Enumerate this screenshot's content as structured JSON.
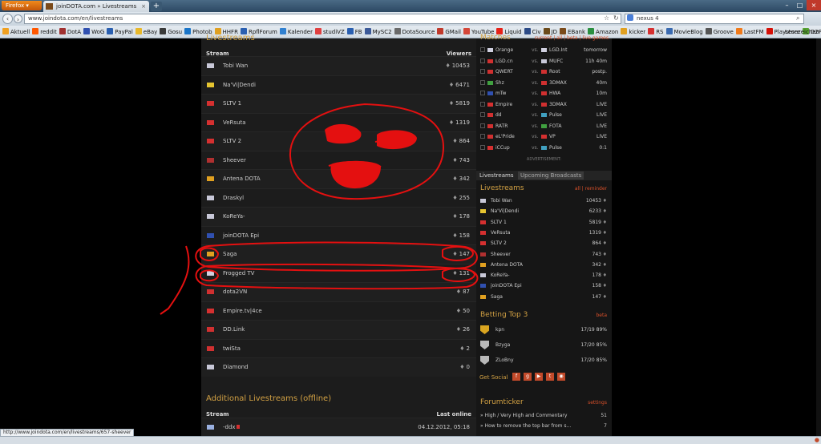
{
  "browser": {
    "menu_label": "Firefox",
    "tab_title": "joinDOTA.com » Livestreams",
    "url": "www.joindota.com/en/livestreams",
    "search_value": "nexus 4",
    "status_url": "http://www.joindota.com/en/livestreams/657-sheever",
    "bookmarks": [
      "Aktuell",
      "reddit",
      "DotA",
      "WoG",
      "PayPal",
      "eBay",
      "Gosu",
      "Photob",
      "HHFR",
      "RpflForum",
      "Kalender",
      "studiVZ",
      "FB",
      "MySC2",
      "DotaSource",
      "GMail",
      "YouTube",
      "Liquid",
      "Civ",
      "JD",
      "EBank",
      "Amazon",
      "kicker",
      "RS",
      "MovieBlog",
      "Groove",
      "LastFM",
      "Playstore",
      "D2PU"
    ],
    "bookmarks_end": "Lesezeichen"
  },
  "main": {
    "title": "Livestreams",
    "col_stream": "Stream",
    "col_viewers": "Viewers",
    "streams": [
      {
        "name": "Tobi Wan",
        "viewers": "10453",
        "flag": "#c8c8d8"
      },
      {
        "name": "Na'Vi|Dendi",
        "viewers": "6471",
        "flag": "#e5c430"
      },
      {
        "name": "SLTV 1",
        "viewers": "5819",
        "flag": "#d53030"
      },
      {
        "name": "VeRsuta",
        "viewers": "1319",
        "flag": "#d53030"
      },
      {
        "name": "SLTV 2",
        "viewers": "864",
        "flag": "#d53030"
      },
      {
        "name": "Sheever",
        "viewers": "743",
        "flag": "#b03030"
      },
      {
        "name": "Antena DOTA",
        "viewers": "342",
        "flag": "#e0a020"
      },
      {
        "name": "Draskyl",
        "viewers": "255",
        "flag": "#c8c8d8"
      },
      {
        "name": "KoReYa-",
        "viewers": "178",
        "flag": "#c8c8d8"
      },
      {
        "name": "joinDOTA Epi",
        "viewers": "158",
        "flag": "#3050b0"
      },
      {
        "name": "Saga",
        "viewers": "147",
        "flag": "#e0a020"
      },
      {
        "name": "Frogged TV",
        "viewers": "131",
        "flag": "#d0d0e0"
      },
      {
        "name": "dota2VN",
        "viewers": "87",
        "flag": "#d03030"
      },
      {
        "name": "Empire.tv|4ce",
        "viewers": "50",
        "flag": "#d53030"
      },
      {
        "name": "DD.Link",
        "viewers": "26",
        "flag": "#d03030"
      },
      {
        "name": "twiSta",
        "viewers": "2",
        "flag": "#d03030"
      },
      {
        "name": "Diamond",
        "viewers": "0",
        "flag": "#c8c8d8"
      }
    ],
    "offline_title": "Additional Livestreams (offline)",
    "offline_col_stream": "Stream",
    "offline_col_last": "Last online",
    "offline_rows": [
      {
        "name": "-ddx",
        "last": "04.12.2012, 05:18",
        "flag": "#9ab0e0"
      }
    ]
  },
  "side": {
    "matches_title": "Matches",
    "matches_links": "current | all | beta | live games",
    "matches": [
      {
        "t1": "Orange",
        "t2": "LGD.Int",
        "time": "tomorrow",
        "f1": "#d0d0e0",
        "f2": "#d0d0e0"
      },
      {
        "t1": "LGD.cn",
        "t2": "MUFC",
        "time": "11h 40m",
        "f1": "#d03030",
        "f2": "#c8c8d8"
      },
      {
        "t1": "QWERT",
        "t2": "Root",
        "time": "postp.",
        "f1": "#d03030",
        "f2": "#d03030"
      },
      {
        "t1": "Shz",
        "t2": "3DMAX",
        "time": "40m",
        "f1": "#40a040",
        "f2": "#d03030"
      },
      {
        "t1": "mTw",
        "t2": "HWA",
        "time": "10m",
        "f1": "#3050b0",
        "f2": "#d03030"
      },
      {
        "t1": "Empire",
        "t2": "3DMAX",
        "time": "LIVE",
        "f1": "#d53030",
        "f2": "#d03030"
      },
      {
        "t1": "dd",
        "t2": "Pulse",
        "time": "LIVE",
        "f1": "#d03030",
        "f2": "#40a0c0"
      },
      {
        "t1": "RATR",
        "t2": "FOTA",
        "time": "LIVE",
        "f1": "#d03030",
        "f2": "#40a040"
      },
      {
        "t1": "eL'Pride",
        "t2": "VP",
        "time": "LIVE",
        "f1": "#d03030",
        "f2": "#d53030"
      },
      {
        "t1": "iCCup",
        "t2": "Pulse",
        "time": "0:1",
        "f1": "#d53030",
        "f2": "#40a0c0"
      }
    ],
    "advertisement": "ADVERTISEMENT:",
    "tab_live": "Livestreams",
    "tab_upcoming": "Upcoming Broadcasts",
    "live_title": "Livestreams",
    "live_links": "all | reminder",
    "live_streams": [
      {
        "name": "Tobi Wan",
        "viewers": "10453",
        "flag": "#c8c8d8"
      },
      {
        "name": "Na'Vi|Dendi",
        "viewers": "6233",
        "flag": "#e5c430"
      },
      {
        "name": "SLTV 1",
        "viewers": "5819",
        "flag": "#d53030"
      },
      {
        "name": "VeRsuta",
        "viewers": "1319",
        "flag": "#d53030"
      },
      {
        "name": "SLTV 2",
        "viewers": "864",
        "flag": "#d53030"
      },
      {
        "name": "Sheever",
        "viewers": "743",
        "flag": "#b03030"
      },
      {
        "name": "Antena DOTA",
        "viewers": "342",
        "flag": "#e0a020"
      },
      {
        "name": "KoReYa-",
        "viewers": "178",
        "flag": "#c8c8d8"
      },
      {
        "name": "joinDOTA Epi",
        "viewers": "158",
        "flag": "#3050b0"
      },
      {
        "name": "Saga",
        "viewers": "147",
        "flag": "#e0a020"
      }
    ],
    "betting_title": "Betting Top 3",
    "betting_link": "beta",
    "betting": [
      {
        "name": "kpn",
        "score": "17/19 89%",
        "medal": "#d9a520"
      },
      {
        "name": "Bzyga",
        "score": "17/20 85%",
        "medal": "#b8b8b8"
      },
      {
        "name": "ZLoBny",
        "score": "17/20 85%",
        "medal": "#b8b8b8"
      }
    ],
    "social_title": "Get Social",
    "forum_title": "Forumticker",
    "forum_link": "settings",
    "forum": [
      {
        "name": "High / Very High and Commentary",
        "count": "51"
      },
      {
        "name": "How to remove the top bar from s...",
        "count": "7"
      }
    ]
  },
  "colors": {
    "accent": "#d1a043",
    "link_red": "#d9502a",
    "scribble": "#e41010"
  }
}
